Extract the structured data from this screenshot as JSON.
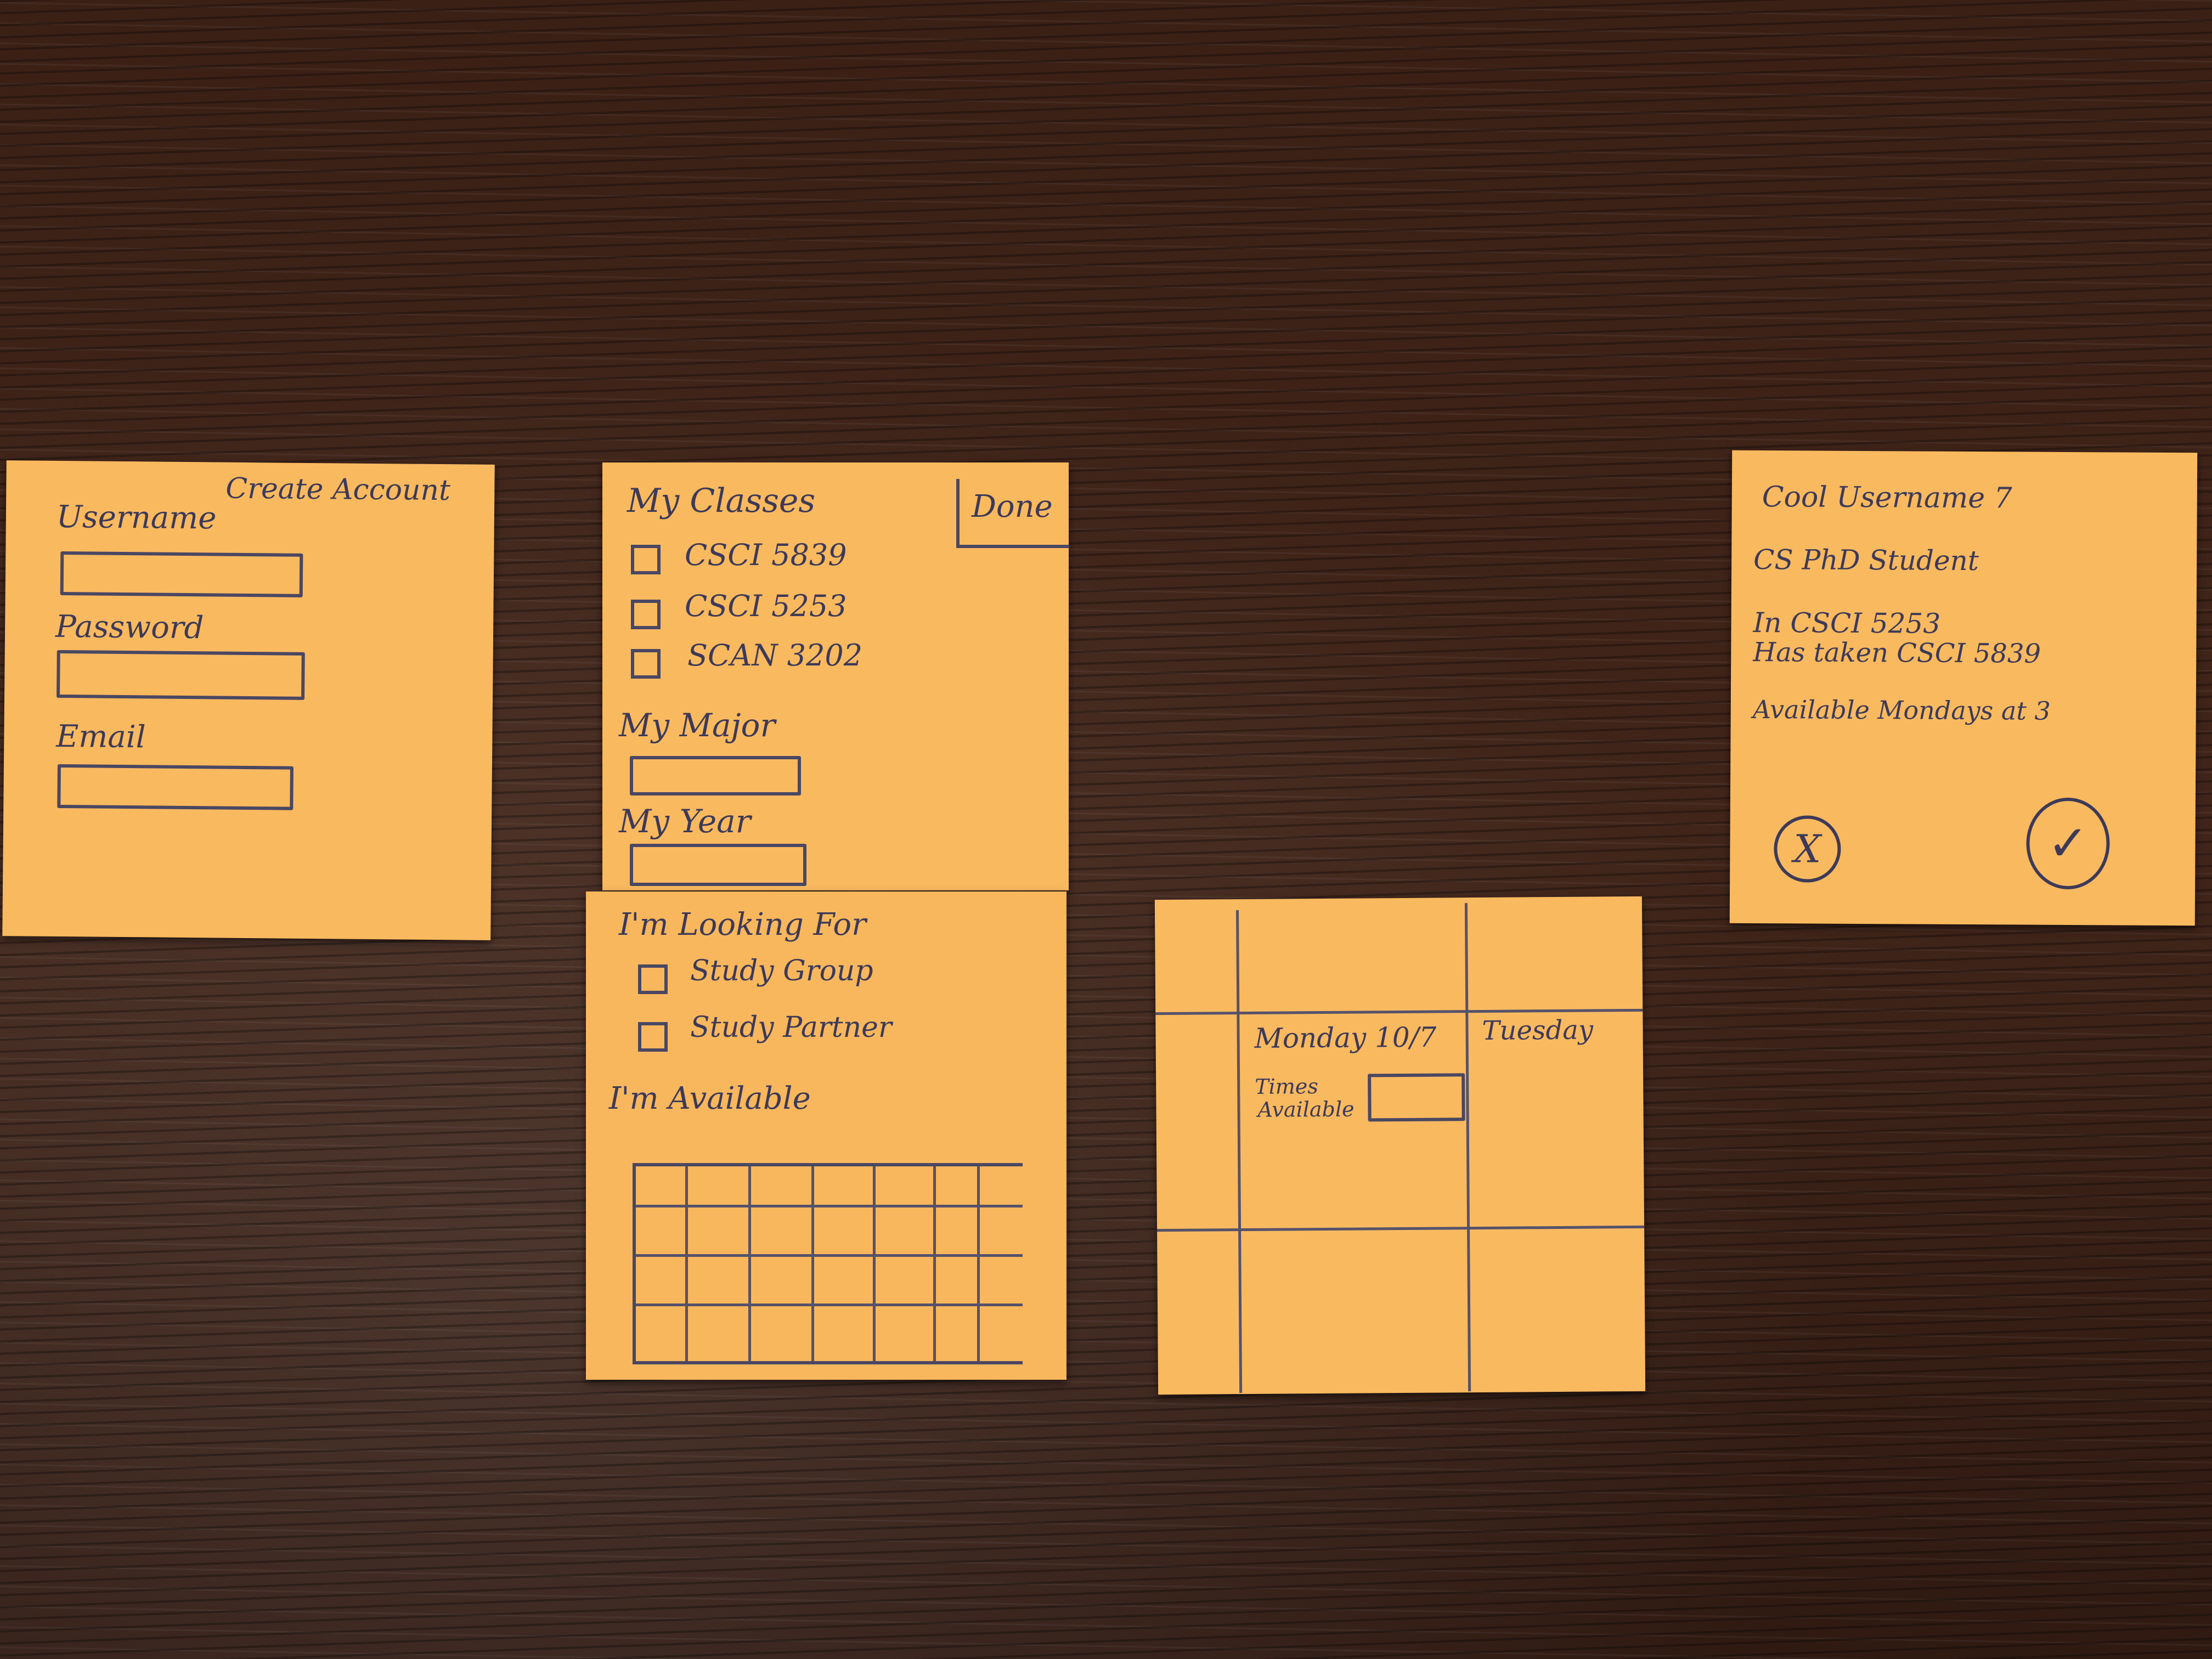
{
  "create_account": {
    "title": "Create Account",
    "username_label": "Username",
    "password_label": "Password",
    "email_label": "Email"
  },
  "profile_setup": {
    "classes_heading": "My Classes",
    "done_label": "Done",
    "classes": [
      {
        "label": "CSCI 5839",
        "checked": false
      },
      {
        "label": "CSCI 5253",
        "checked": false
      },
      {
        "label": "SCAN 3202",
        "checked": false
      }
    ],
    "major_label": "My Major",
    "year_label": "My Year"
  },
  "preferences": {
    "looking_for_heading": "I'm Looking For",
    "options": [
      {
        "label": "Study Group",
        "checked": false
      },
      {
        "label": "Study Partner",
        "checked": false
      }
    ],
    "available_heading": "I'm Available"
  },
  "calendar": {
    "day1": "Monday 10/7",
    "day2": "Tuesday",
    "times_label_line1": "Times",
    "times_label_line2": "Available"
  },
  "match_card": {
    "username": "Cool Username 7",
    "role": "CS PhD Student",
    "current_class": "In CSCI 5253",
    "taken_class": "Has taken CSCI 5839",
    "availability": "Available Mondays at 3",
    "reject_icon": "x",
    "accept_icon": "check",
    "reject_symbol": "X",
    "accept_symbol": "✓"
  }
}
